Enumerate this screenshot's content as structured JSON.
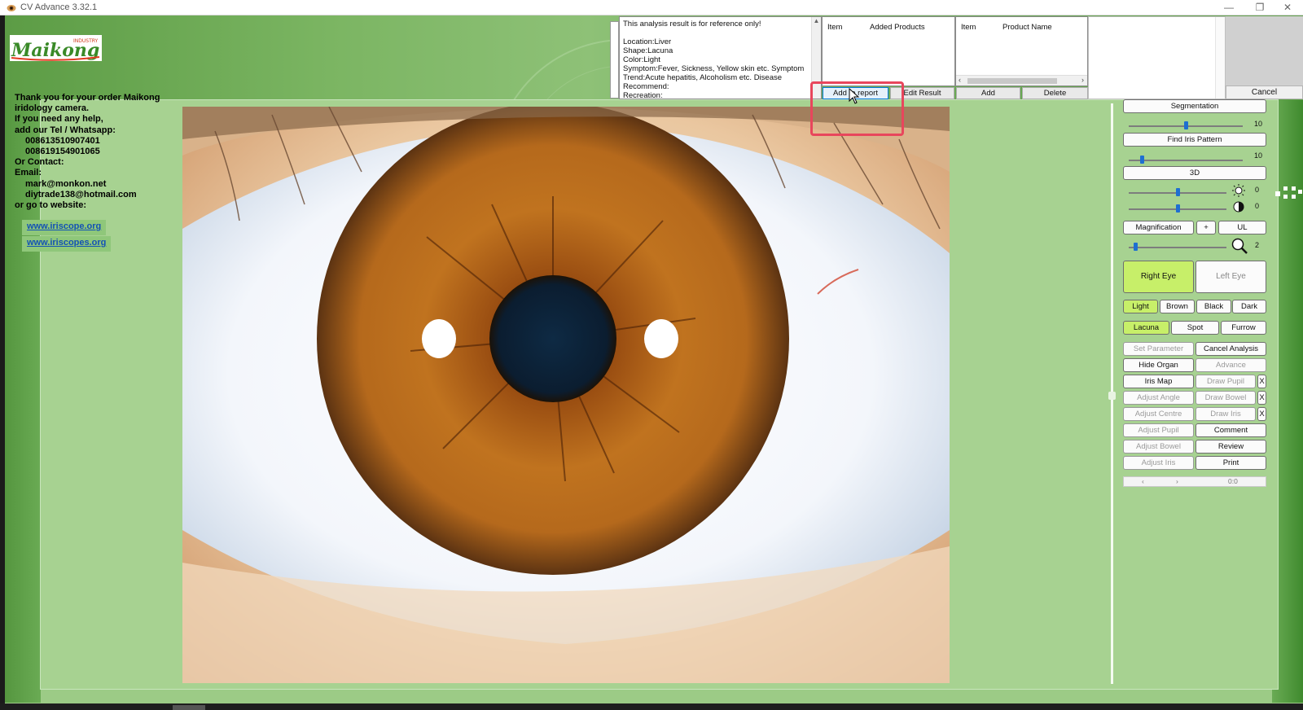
{
  "window": {
    "title": "CV Advance 3.32.1",
    "controls": {
      "minimize": "—",
      "restore": "❐",
      "close": "✕"
    }
  },
  "colors": {
    "accent_selected": "#c7ef69",
    "background_green": "#a7d291",
    "highlight_box": "#e8465c"
  },
  "logo": {
    "text": "Maikong",
    "subtext": "INDUSTRY"
  },
  "contact": {
    "lines": [
      "Thank you for your order Maikong",
      "iridology camera.",
      "If you need any help,",
      "add our  Tel / Whatsapp:",
      "008613510907401",
      "008619154901065",
      "Or Contact:",
      "Email:",
      "mark@monkon.net",
      "diytrade138@hotmail.com",
      "or go to website:"
    ],
    "links": [
      "www.iriscope.org",
      "www.iriscopes.org"
    ]
  },
  "analysis": {
    "lines": [
      "This analysis result is for reference only!",
      "",
      "Location:Liver",
      "Shape:Lacuna",
      "Color:Light",
      "Symptom:Fever, Sickness, Yellow skin etc. Symptom",
      "Trend:Acute hepatitis, Alcoholism etc. Disease",
      "Recommend:",
      "Recreation:"
    ]
  },
  "lists": {
    "added": {
      "col1": "Item",
      "col2": "Added Products"
    },
    "products": {
      "col1": "Item",
      "col2": "Product Name"
    }
  },
  "toolbar": {
    "add_to_report": "Add to report",
    "edit_result": "Edit Result",
    "add": "Add",
    "delete": "Delete",
    "cancel": "Cancel"
  },
  "controls": {
    "segmentation": "Segmentation",
    "segmentation_value": "10",
    "find_iris_pattern": "Find Iris Pattern",
    "find_value": "10",
    "three_d": "3D",
    "brightness_value": "0",
    "contrast_value": "0",
    "magnification": "Magnification",
    "plus": "+",
    "ul": "UL",
    "zoom_value": "2",
    "right_eye": "Right Eye",
    "left_eye": "Left Eye",
    "colors": [
      "Light",
      "Brown",
      "Black",
      "Dark"
    ],
    "shapes": [
      "Lacuna",
      "Spot",
      "Furrow"
    ],
    "set_parameter": "Set Parameter",
    "cancel_analysis": "Cancel Analysis",
    "hide_organ": "Hide Organ",
    "advance": "Advance",
    "iris_map": "Iris Map",
    "draw_pupil": "Draw Pupil",
    "adjust_angle": "Adjust Angle",
    "draw_bowel": "Draw Bowel",
    "adjust_centre": "Adjust Centre",
    "draw_iris": "Draw Iris",
    "adjust_pupil": "Adjust Pupil",
    "comment": "Comment",
    "adjust_bowel": "Adjust Bowel",
    "review": "Review",
    "adjust_iris": "Adjust Iris",
    "print": "Print",
    "x": "X",
    "nav_prev": "‹",
    "nav_next": "›",
    "nav_value": "0:0",
    "segmentation_level": 0.5,
    "find_level": 0.1,
    "brightness_level": 0.5,
    "contrast_level": 0.5,
    "zoom_level": 0.05
  },
  "state": {
    "selected_eye": "Right Eye",
    "selected_color": "Light",
    "selected_shape": "Lacuna"
  }
}
